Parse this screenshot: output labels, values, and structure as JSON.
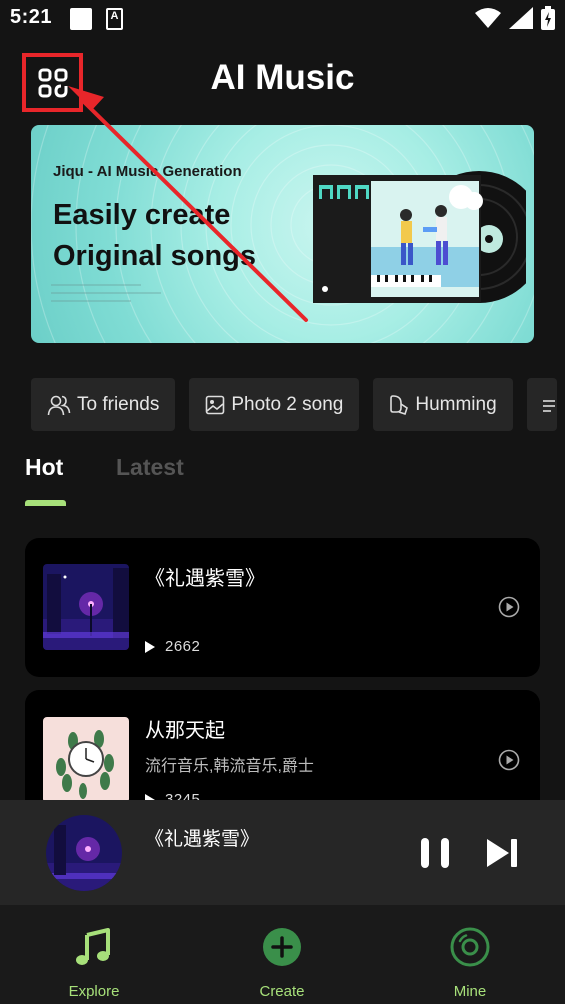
{
  "status_bar": {
    "time": "5:21",
    "a_glyph": "A"
  },
  "header": {
    "title": "AI Music",
    "menu_icon": "grid-menu-icon"
  },
  "banner": {
    "subtitle": "Jiqu - AI Music Generation",
    "headline_line1": "Easily create",
    "headline_line2": "Original songs"
  },
  "features": [
    {
      "label": "To friends",
      "icon": "friends-icon"
    },
    {
      "label": "Photo 2 song",
      "icon": "photo-icon"
    },
    {
      "label": "Humming",
      "icon": "humming-icon"
    }
  ],
  "tabs": {
    "hot": "Hot",
    "latest": "Latest",
    "active": "Hot"
  },
  "songs": [
    {
      "title": "《礼遇紫雪》",
      "genre": "",
      "plays": "2662"
    },
    {
      "title": "从那天起",
      "genre": "流行音乐,韩流音乐,爵士",
      "plays": "3245"
    }
  ],
  "now_playing": {
    "title": "《礼遇紫雪》",
    "state": "playing"
  },
  "bottom_nav": [
    {
      "label": "Explore",
      "icon": "music-note-icon"
    },
    {
      "label": "Create",
      "icon": "plus-circle-icon"
    },
    {
      "label": "Mine",
      "icon": "disc-icon"
    }
  ],
  "colors": {
    "accent_green": "#a7e07a",
    "highlight_red": "#e8262a",
    "background": "#141414",
    "card": "#000000"
  }
}
